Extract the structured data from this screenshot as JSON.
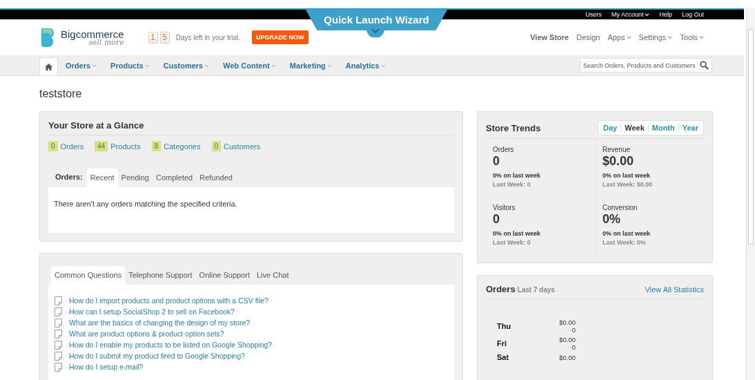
{
  "top_links": [
    {
      "label": "Users",
      "dropdown": false
    },
    {
      "label": "My Account",
      "dropdown": true
    },
    {
      "label": "Help",
      "dropdown": false
    },
    {
      "label": "Log Out",
      "dropdown": false
    }
  ],
  "wizard": {
    "label": "Quick Launch Wizard"
  },
  "logo": {
    "name": "Bigcommerce",
    "tagline": "sell more"
  },
  "trial": {
    "digits": [
      "1",
      "5"
    ],
    "text": "Days left in your trial.",
    "button": "UPGRADE NOW"
  },
  "header_links": [
    {
      "label": "View Store",
      "dropdown": false,
      "bold": true
    },
    {
      "label": "Design",
      "dropdown": false,
      "bold": false
    },
    {
      "label": "Apps",
      "dropdown": true,
      "bold": false
    },
    {
      "label": "Settings",
      "dropdown": true,
      "bold": false
    },
    {
      "label": "Tools",
      "dropdown": true,
      "bold": false
    }
  ],
  "nav": {
    "items": [
      "Orders",
      "Products",
      "Customers",
      "Web Content",
      "Marketing",
      "Analytics"
    ],
    "search_placeholder": "Search Orders, Products and Customers"
  },
  "store_name": "teststore",
  "glance": {
    "title": "Your Store at a Glance",
    "stats": [
      {
        "count": "0",
        "label": "Orders"
      },
      {
        "count": "44",
        "label": "Products"
      },
      {
        "count": "8",
        "label": "Categories"
      },
      {
        "count": "0",
        "label": "Customers"
      }
    ],
    "tabs_label": "Orders:",
    "tabs": [
      {
        "label": "Recent",
        "selected": true
      },
      {
        "label": "Pending",
        "selected": false
      },
      {
        "label": "Completed",
        "selected": false
      },
      {
        "label": "Refunded",
        "selected": false
      }
    ],
    "message": "There aren't any orders matching the specified criteria."
  },
  "support": {
    "tabs": [
      {
        "label": "Common Questions",
        "selected": true
      },
      {
        "label": "Telephone Support",
        "selected": false
      },
      {
        "label": "Online Support",
        "selected": false
      },
      {
        "label": "Live Chat",
        "selected": false
      }
    ],
    "questions": [
      "How do I import products and product options with a CSV file?",
      "How can I setup SocialShop 2 to sell on Facebook?",
      "What are the basics of changing the design of my store?",
      "What are product options & product option sets?",
      "How do I enable my products to be listed on Google Shopping?",
      "How do I submit my product feed to Google Shopping?",
      "How do I setup e-mail?"
    ]
  },
  "trends": {
    "title": "Store Trends",
    "periods": [
      {
        "label": "Day",
        "selected": false
      },
      {
        "label": "Week",
        "selected": true
      },
      {
        "label": "Month",
        "selected": false
      },
      {
        "label": "Year",
        "selected": false
      }
    ],
    "metrics": [
      {
        "label": "Orders",
        "value": "0",
        "change": "0% on last week",
        "last": "Last Week: 0"
      },
      {
        "label": "Revenue",
        "value": "$0.00",
        "change": "0% on last week",
        "last": "Last Week: $0.00"
      },
      {
        "label": "Visitors",
        "value": "0",
        "change": "0% on last week",
        "last": "Last Week: 0"
      },
      {
        "label": "Conversion",
        "value": "0%",
        "change": "0% on last week",
        "last": "Last Week: 0%"
      }
    ]
  },
  "orders": {
    "title": "Orders",
    "subtitle": "Last 7 days",
    "link": "View All Statistics",
    "days": [
      {
        "day": "Thu",
        "amount": "$0.00",
        "count": "0"
      },
      {
        "day": "Fri",
        "amount": "$0.00",
        "count": "0"
      },
      {
        "day": "Sat",
        "amount": "$0.00"
      }
    ]
  }
}
